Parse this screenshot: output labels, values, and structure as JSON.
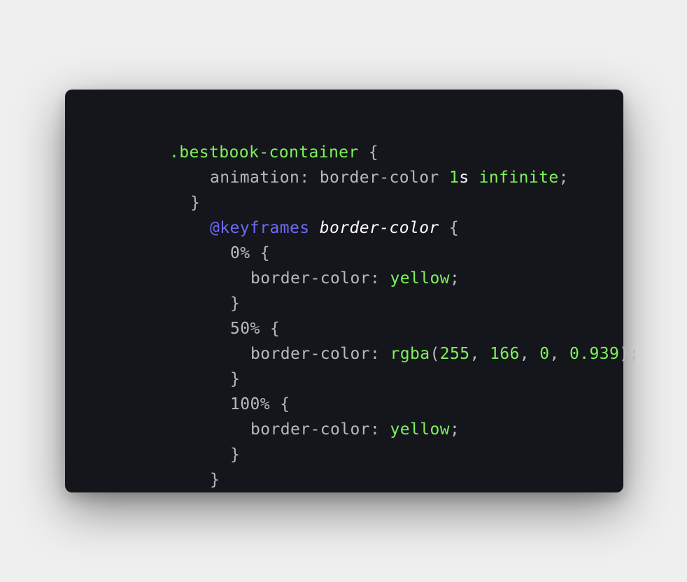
{
  "colors": {
    "background": "#efefef",
    "editor_background": "#15161c",
    "selector": "#7ef25a",
    "property": "#b7b9bf",
    "at_rule": "#6e6af7",
    "plain_value": "#ffffff",
    "keyword_value": "#7ef25a"
  },
  "code": {
    "line1": {
      "selector": ".bestbook-container",
      "brace": " {"
    },
    "line2": {
      "prop": "animation:",
      "value_name": " border-color ",
      "num": "1",
      "unit": "s",
      "keyword": " infinite",
      "semi": ";"
    },
    "line3": {
      "brace": "}"
    },
    "line4": {
      "at_rule": "@keyframes",
      "name": " border-color",
      "brace": " {"
    },
    "line5": {
      "step": "0%",
      "brace": " {"
    },
    "line6": {
      "prop": "border-color:",
      "value": " yellow",
      "semi": ";"
    },
    "line7": {
      "brace": "}"
    },
    "line8": {
      "step": "50%",
      "brace": " {"
    },
    "line9": {
      "prop": "border-color:",
      "func": " rgba",
      "open": "(",
      "v1": "255",
      "c1": ", ",
      "v2": "166",
      "c2": ", ",
      "v3": "0",
      "c3": ", ",
      "v4": "0.939",
      "close": ");"
    },
    "line10": {
      "brace": "}"
    },
    "line11": {
      "step": "100%",
      "brace": " {"
    },
    "line12": {
      "prop": "border-color:",
      "value": " yellow",
      "semi": ";"
    },
    "line13": {
      "brace": "}"
    },
    "line14": {
      "brace": "}"
    }
  }
}
